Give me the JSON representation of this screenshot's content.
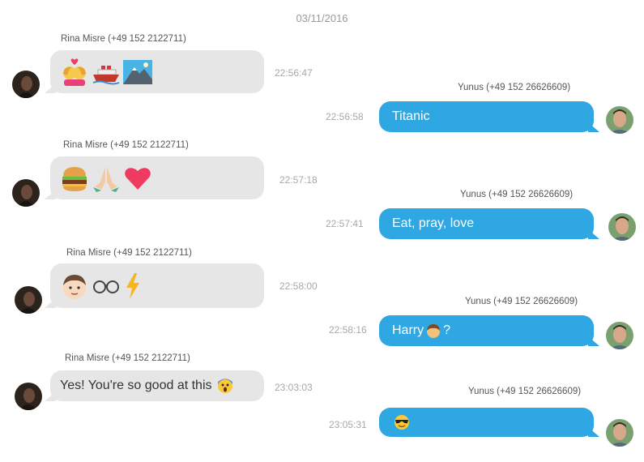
{
  "date": "03/11/2016",
  "contacts": {
    "rina": "Rina Misre (+49 152  2122711)",
    "yunus": "Yunus (+49 152 26626609)"
  },
  "messages": [
    {
      "time": "22:56:47",
      "emojis": [
        "couple-heart-icon",
        "ship-icon",
        "mountain-icon"
      ]
    },
    {
      "time": "22:56:58",
      "text": "Titanic"
    },
    {
      "time": "22:57:18",
      "emojis": [
        "burger-icon",
        "praying-hands-icon",
        "heart-icon"
      ]
    },
    {
      "time": "22:57:41",
      "text": "Eat, pray, love"
    },
    {
      "time": "22:58:00",
      "emojis": [
        "boy-face-icon",
        "glasses-icon",
        "lightning-icon"
      ]
    },
    {
      "time": "22:58:16",
      "text_before": "Harry",
      "text_after": "?",
      "emoji": "hairy-head-icon"
    },
    {
      "time": "23:03:03",
      "text": "Yes! You're so good at this",
      "emoji": "scream-face-icon"
    },
    {
      "time": "23:05:31",
      "emoji": "sunglasses-face-icon"
    }
  ],
  "colors": {
    "incoming_bubble": "#e6e6e6",
    "outgoing_bubble": "#2ea7e3",
    "timestamp": "#a8a8a8"
  }
}
